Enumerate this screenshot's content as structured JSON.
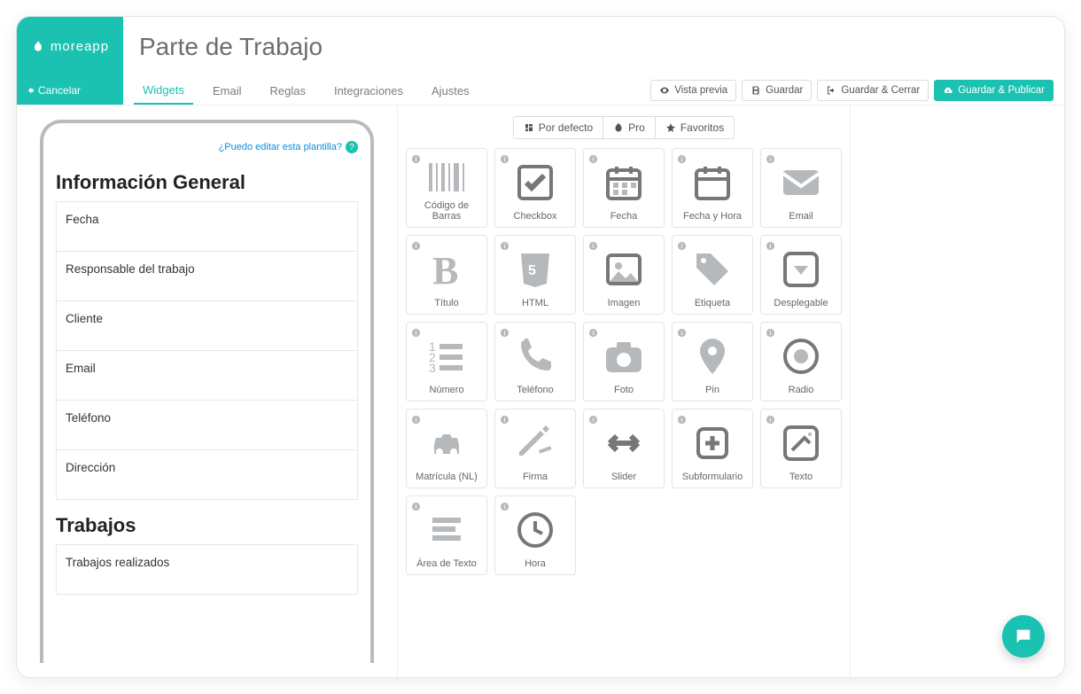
{
  "brand": {
    "name": "moreapp"
  },
  "title": "Parte de Trabajo",
  "cancel": "Cancelar",
  "tabs": [
    "Widgets",
    "Email",
    "Reglas",
    "Integraciones",
    "Ajustes"
  ],
  "activeTab": 0,
  "actions": {
    "preview": "Vista previa",
    "save": "Guardar",
    "saveClose": "Guardar & Cerrar",
    "savePublish": "Guardar & Publicar"
  },
  "helpLink": "¿Puedo editar esta plantilla?",
  "form": {
    "sections": [
      {
        "title": "Información General",
        "fields": [
          "Fecha",
          "Responsable del trabajo",
          "Cliente",
          "Email",
          "Teléfono",
          "Dirección"
        ]
      },
      {
        "title": "Trabajos",
        "fields": [
          "Trabajos realizados"
        ]
      }
    ]
  },
  "filters": [
    "Por defecto",
    "Pro",
    "Favoritos"
  ],
  "widgets": [
    {
      "id": "barcode",
      "label": "Código de Barras"
    },
    {
      "id": "checkbox",
      "label": "Checkbox"
    },
    {
      "id": "date",
      "label": "Fecha"
    },
    {
      "id": "datetime",
      "label": "Fecha y Hora"
    },
    {
      "id": "email",
      "label": "Email"
    },
    {
      "id": "title",
      "label": "Título"
    },
    {
      "id": "html",
      "label": "HTML"
    },
    {
      "id": "image",
      "label": "Imagen"
    },
    {
      "id": "tag",
      "label": "Etiqueta"
    },
    {
      "id": "dropdown",
      "label": "Desplegable"
    },
    {
      "id": "number",
      "label": "Número"
    },
    {
      "id": "phone",
      "label": "Teléfono"
    },
    {
      "id": "photo",
      "label": "Foto"
    },
    {
      "id": "pin",
      "label": "Pin"
    },
    {
      "id": "radio",
      "label": "Radio"
    },
    {
      "id": "plate",
      "label": "Matrícula (NL)"
    },
    {
      "id": "signature",
      "label": "Firma"
    },
    {
      "id": "slider",
      "label": "Slider"
    },
    {
      "id": "subform",
      "label": "Subformulario"
    },
    {
      "id": "text",
      "label": "Texto"
    },
    {
      "id": "textarea",
      "label": "Área de Texto"
    },
    {
      "id": "time",
      "label": "Hora"
    }
  ]
}
